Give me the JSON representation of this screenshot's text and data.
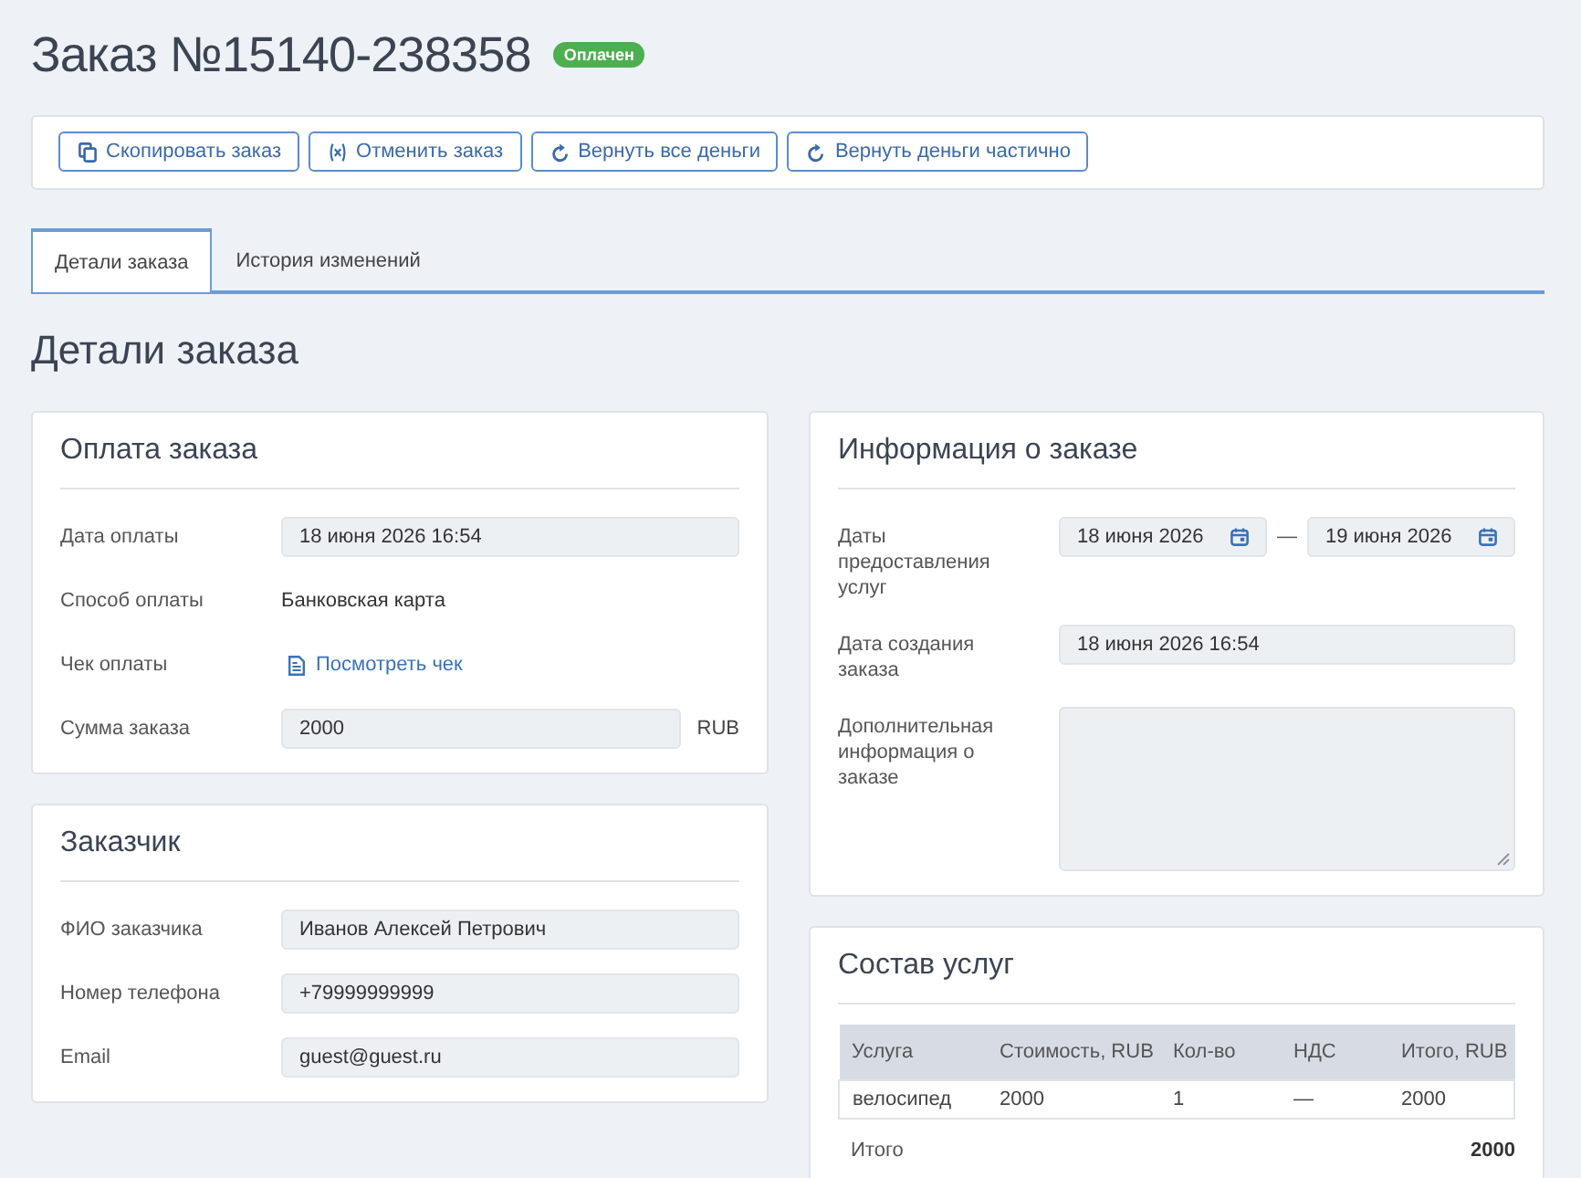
{
  "header": {
    "title": "Заказ №15140-238358",
    "status": "Оплачен"
  },
  "actions": [
    {
      "label": "Скопировать заказ",
      "kind": "copy"
    },
    {
      "label": "Отменить заказ",
      "kind": "cancel"
    },
    {
      "label": "Вернуть все деньги",
      "kind": "refund"
    },
    {
      "label": "Вернуть деньги частично",
      "kind": "refund"
    }
  ],
  "tabs": [
    {
      "label": "Детали заказа",
      "selected": true
    },
    {
      "label": "История изменений",
      "selected": false
    }
  ],
  "section_title": "Детали заказа",
  "payment": {
    "title": "Оплата заказа",
    "fields": [
      {
        "label": "Дата оплаты",
        "kind": "input",
        "value": "18 июня 2026 16:54"
      },
      {
        "label": "Способ оплаты",
        "kind": "text",
        "value": "Банковская карта"
      },
      {
        "label": "Чек оплаты",
        "kind": "link",
        "value": "Посмотреть чек"
      },
      {
        "label": "Сумма заказа",
        "kind": "amount",
        "value": "2000",
        "unit": "RUB"
      }
    ]
  },
  "customer": {
    "title": "Заказчик",
    "fields": [
      {
        "label": "ФИО заказчика",
        "kind": "input",
        "value": "Иванов Алексей Петрович"
      },
      {
        "label": "Номер телефона",
        "kind": "input",
        "value": "+79999999999"
      },
      {
        "label": "Email",
        "kind": "input",
        "value": "guest@guest.ru"
      }
    ]
  },
  "order_info": {
    "title": "Информация о заказе",
    "fields": [
      {
        "label": "Даты предоставления услуг",
        "kind": "date_range",
        "from": "18 июня 2026",
        "separator": "—",
        "to": "19 июня 2026"
      },
      {
        "label": "Дата создания заказа",
        "kind": "input",
        "value": "18 июня 2026 16:54"
      },
      {
        "label": "Дополнительная информация о заказе",
        "kind": "textarea"
      }
    ]
  },
  "services": {
    "title": "Состав услуг",
    "table": {
      "columns": [
        "Услуга",
        "Стоимость, RUB",
        "Кол-во",
        "НДС",
        "Итого, RUB"
      ],
      "rows": [
        [
          "велосипед",
          "2000",
          "1",
          "—",
          "2000"
        ]
      ]
    },
    "total": {
      "label": "Итого",
      "value": "2000"
    }
  }
}
